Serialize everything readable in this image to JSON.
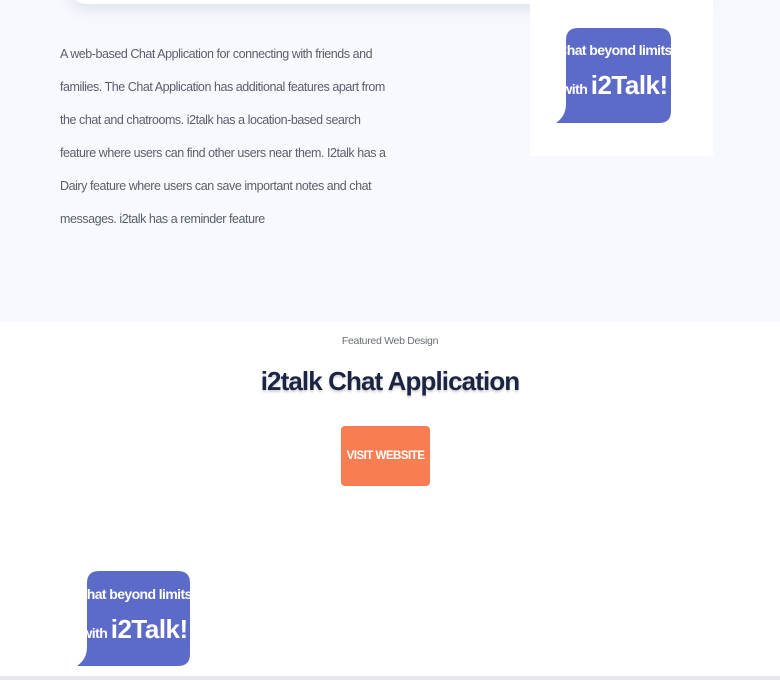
{
  "project": {
    "description": "A web-based Chat Application for connecting with friends and families. The Chat Application has additional features apart from the chat and chatrooms. i2talk has a location-based search feature where users can find other users near them. I2talk has a Dairy feature where users can save important notes and chat messages. i2talk has a reminder feature",
    "featured_label": "Featured Web Design",
    "title": "i2talk Chat Application",
    "visit_button_label": "VISIT WEBSITE"
  },
  "logo": {
    "line1": "Chat beyond limits",
    "line2_prefix": "with ",
    "line2_brand": "i2Talk!",
    "bubble_color": "#5b6bc7"
  },
  "colors": {
    "accent_button": "#f77e53",
    "title_text": "#1c2444",
    "section_background": "#f7f9fe"
  }
}
